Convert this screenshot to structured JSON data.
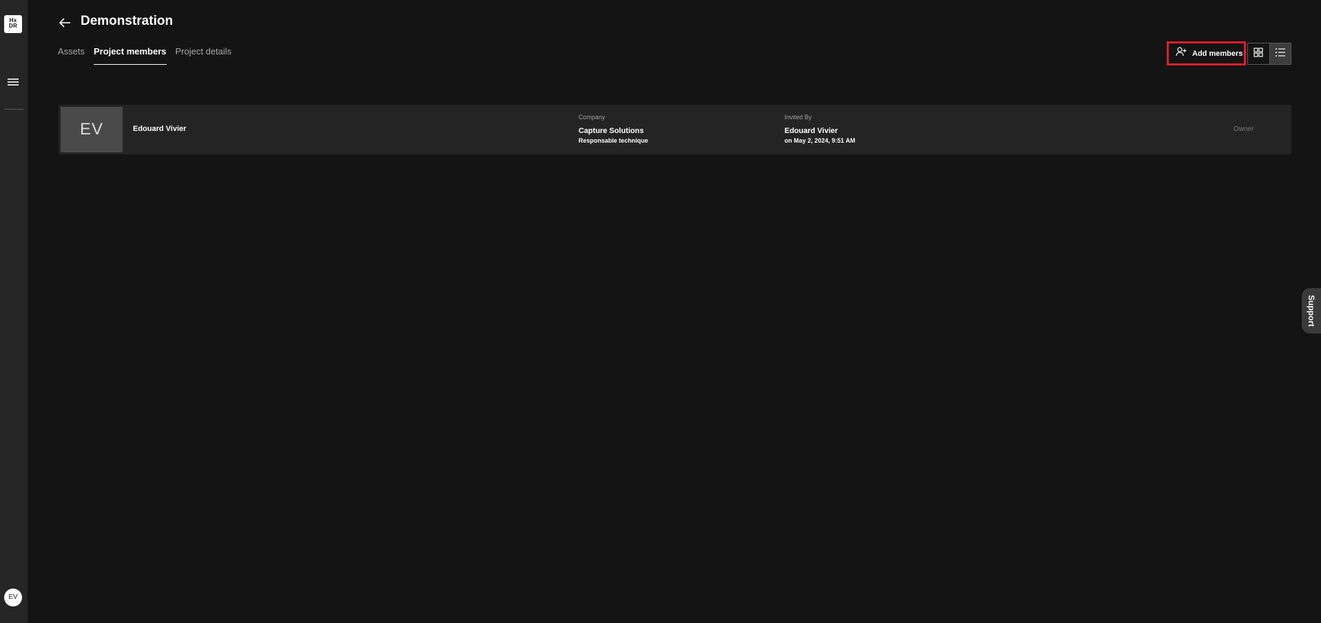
{
  "app": {
    "logo_lines": [
      "Hx",
      "DR"
    ],
    "user_initials": "EV"
  },
  "header": {
    "title": "Demonstration"
  },
  "tabs": [
    {
      "label": "Assets",
      "active": false
    },
    {
      "label": "Project members",
      "active": true
    },
    {
      "label": "Project details",
      "active": false
    }
  ],
  "toolbar": {
    "add_members_label": "Add members",
    "view_mode": "list"
  },
  "members": [
    {
      "initials": "EV",
      "name": "Edouard Vivier",
      "company_label": "Company",
      "company": "Capture Solutions",
      "job_title": "Responsable technique",
      "invited_by_label": "Invited By",
      "invited_by": "Edouard Vivier",
      "invited_on": "on May 2, 2024, 9:51 AM",
      "role": "Owner"
    }
  ],
  "support": {
    "label": "Support"
  },
  "colors": {
    "background": "#141414",
    "rail": "#262626",
    "row": "#242424",
    "highlight": "#e01e2b"
  },
  "icons": {
    "back": "arrow-left-icon",
    "menu": "hamburger-menu-icon",
    "add_members": "add-user-icon",
    "grid_view": "grid-view-icon",
    "list_view": "list-view-icon"
  }
}
